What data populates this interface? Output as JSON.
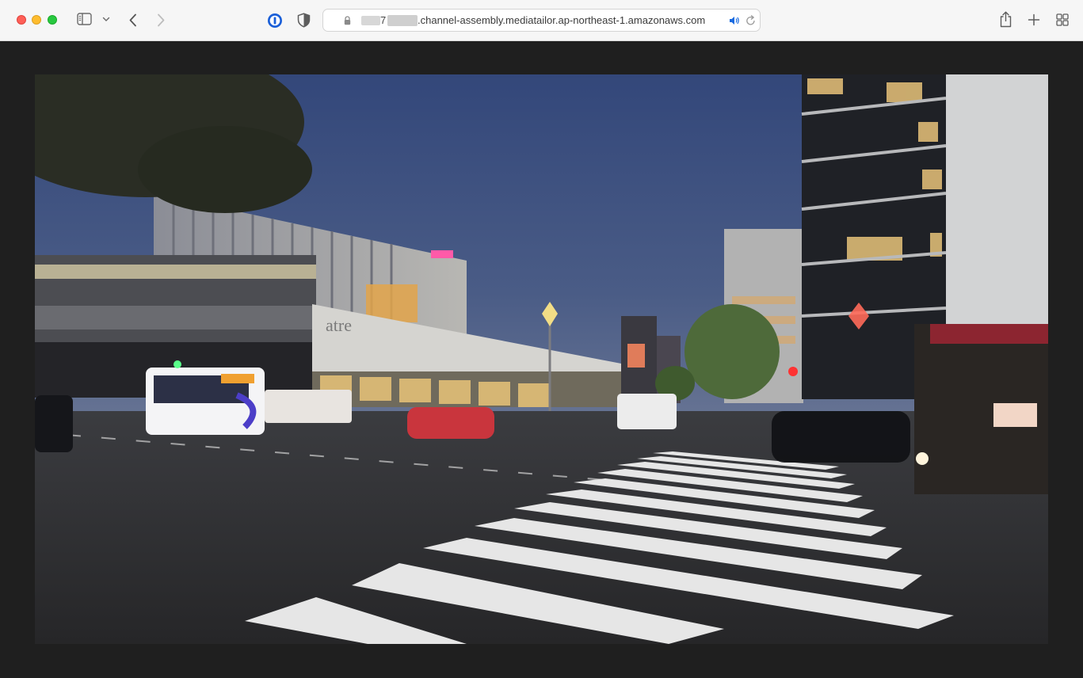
{
  "window": {
    "controls": [
      "close",
      "minimize",
      "zoom"
    ]
  },
  "toolbar": {
    "icons": [
      "sidebar-icon",
      "chevron-down-icon",
      "back-arrow-icon",
      "forward-arrow-icon",
      "password-manager-icon",
      "shield-icon",
      "share-icon",
      "new-tab-icon",
      "tab-overview-icon"
    ]
  },
  "address_bar": {
    "url_prefix_visible": "7",
    "url_domain": ".channel-assembly.mediatailor.ap-northeast-1.amazonaws.com",
    "icons": [
      "lock-icon",
      "speaker-icon",
      "reload-icon"
    ]
  },
  "video": {
    "sign_text": "atre",
    "description_colors": {
      "sky": "#3a4d74",
      "road": "#2f2f31",
      "crosswalk": "#e6e6e6"
    }
  }
}
